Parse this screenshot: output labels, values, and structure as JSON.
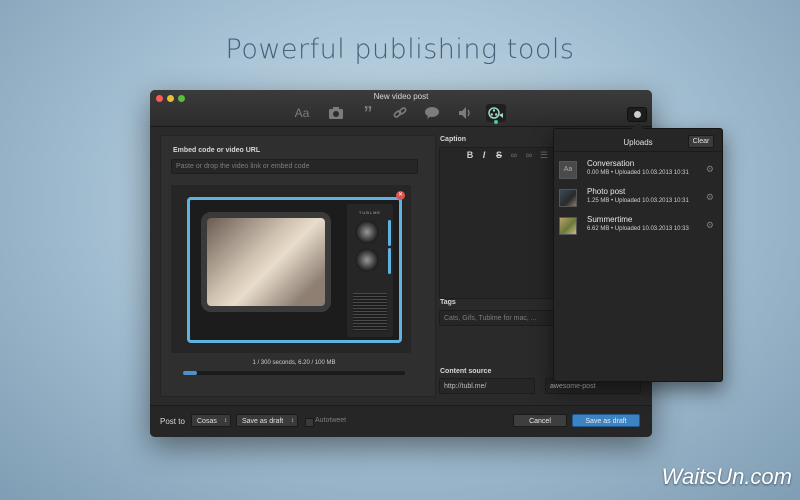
{
  "headline": "Powerful publishing tools",
  "watermark": "WaitsUn.com",
  "window": {
    "title": "New video post",
    "toolbar": [
      {
        "name": "text-icon",
        "glyph": "Aa"
      },
      {
        "name": "camera-icon",
        "glyph": "camera"
      },
      {
        "name": "quote-icon",
        "glyph": "”"
      },
      {
        "name": "link-icon",
        "glyph": "link"
      },
      {
        "name": "chat-icon",
        "glyph": "chat"
      },
      {
        "name": "audio-icon",
        "glyph": "speaker"
      },
      {
        "name": "video-icon",
        "glyph": "film"
      }
    ]
  },
  "embed": {
    "label": "Embed code or video URL",
    "placeholder": "Paste or drop the video link or embed code"
  },
  "video": {
    "tv_brand": "TUBLME",
    "progress_text": "1 / 300 seconds, 6.20 / 100 MB",
    "progress_fraction": 0.062
  },
  "caption": {
    "label": "Caption",
    "format": [
      "B",
      "I",
      "S"
    ]
  },
  "tags": {
    "label": "Tags",
    "placeholder": "Cats, Gifs, Tublme for mac, ..."
  },
  "content_source": {
    "label": "Content source",
    "value": "http://tubl.me/"
  },
  "custom_url": {
    "value": "awesome-post"
  },
  "bottom": {
    "post_to_label": "Post to",
    "blog": "Cosas",
    "state": "Save as draft",
    "autotweet": "Autotweet",
    "cancel": "Cancel",
    "save": "Save as draft"
  },
  "uploads": {
    "title": "Uploads",
    "clear": "Clear",
    "items": [
      {
        "name": "Conversation",
        "meta": "0.00 MB • Uploaded 10.03.2013 10:31"
      },
      {
        "name": "Photo post",
        "meta": "1.25 MB • Uploaded 10.03.2013 10:31"
      },
      {
        "name": "Summertime",
        "meta": "6.62 MB • Uploaded 10.03.2013 10:33"
      }
    ]
  },
  "colors": {
    "accent": "#3c83c4",
    "tv_frame": "#5fb3e3",
    "close": "#fc5b57",
    "minimize": "#e5bf3c",
    "maximize": "#57c038"
  }
}
